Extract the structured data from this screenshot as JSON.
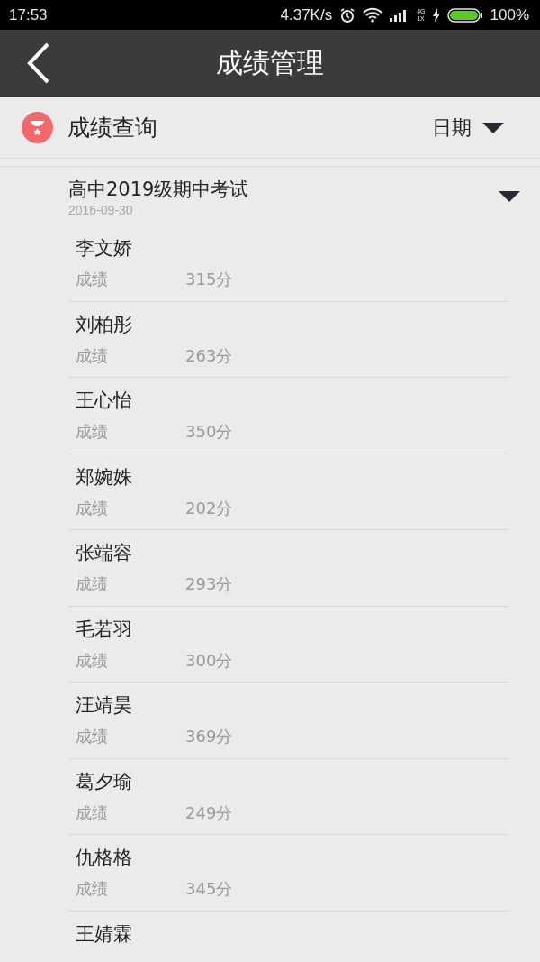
{
  "status_bar": {
    "time": "17:53",
    "speed": "4.37K/s",
    "network": [
      "4G",
      "1X"
    ],
    "battery": "100%"
  },
  "header": {
    "title": "成绩管理"
  },
  "query": {
    "title": "成绩查询",
    "sort": "日期"
  },
  "exam": {
    "title": "高中2019级期中考试",
    "date": "2016-09-30",
    "expanded": true,
    "students": [
      {
        "name": "李文娇",
        "label": "成绩",
        "score": "315分"
      },
      {
        "name": "刘柏彤",
        "label": "成绩",
        "score": "263分"
      },
      {
        "name": "王心怡",
        "label": "成绩",
        "score": "350分"
      },
      {
        "name": "郑婉姝",
        "label": "成绩",
        "score": "202分"
      },
      {
        "name": "张端容",
        "label": "成绩",
        "score": "293分"
      },
      {
        "name": "毛若羽",
        "label": "成绩",
        "score": "300分"
      },
      {
        "name": "汪靖昊",
        "label": "成绩",
        "score": "369分"
      },
      {
        "name": "葛夕瑜",
        "label": "成绩",
        "score": "249分"
      },
      {
        "name": "仇格格",
        "label": "成绩",
        "score": "345分"
      },
      {
        "name": "王婧霖"
      }
    ]
  }
}
